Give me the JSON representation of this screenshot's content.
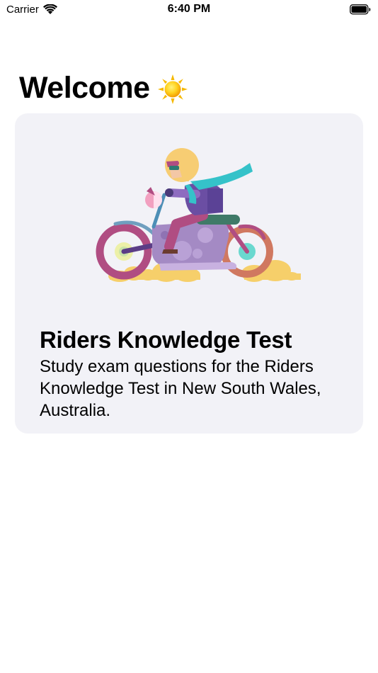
{
  "status_bar": {
    "carrier": "Carrier",
    "time": "6:40 PM"
  },
  "header": {
    "title": "Welcome",
    "icon": "sun-icon"
  },
  "card": {
    "title": "Riders Knowledge Test",
    "description": "Study exam questions for the Riders Knowledge Test in New South Wales, Australia.",
    "illustration": "motorcycle-rider-illustration"
  },
  "colors": {
    "background": "#ffffff",
    "card_background": "#f2f2f7",
    "text": "#000000"
  }
}
